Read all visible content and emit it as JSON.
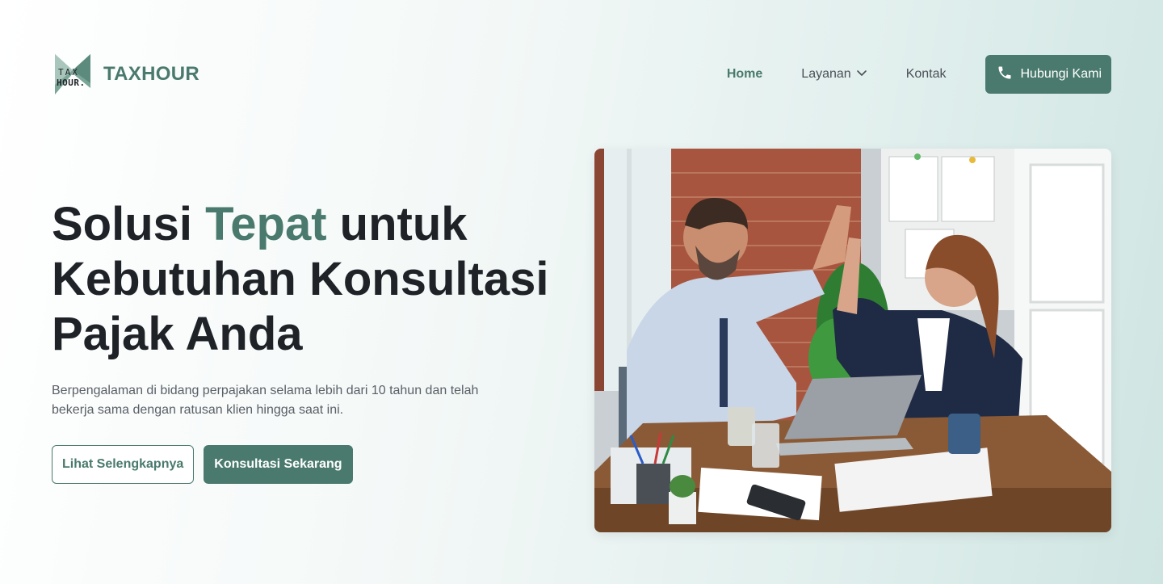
{
  "brand": {
    "logo_top": "TAX",
    "logo_bottom": "HOUR.",
    "name": "TAXHOUR"
  },
  "nav": {
    "items": [
      {
        "label": "Home",
        "active": true
      },
      {
        "label": "Layanan",
        "has_dropdown": true
      },
      {
        "label": "Kontak"
      }
    ],
    "cta_label": "Hubungi Kami",
    "cta_icon": "phone-icon"
  },
  "hero": {
    "title_part1": "Solusi ",
    "title_accent": "Tepat",
    "title_part2": " untuk Kebutuhan Konsultasi Pajak Anda",
    "description": "Berpengalaman di bidang perpajakan selama lebih dari 10 tahun dan telah bekerja sama dengan ratusan klien hingga saat ini.",
    "secondary_button": "Lihat Selengkapnya",
    "primary_button": "Konsultasi Sekarang",
    "image_alt": "business-team-high-five-photo"
  },
  "colors": {
    "accent": "#4a7a6d",
    "text": "#1f2328",
    "muted": "#5a5f66"
  }
}
